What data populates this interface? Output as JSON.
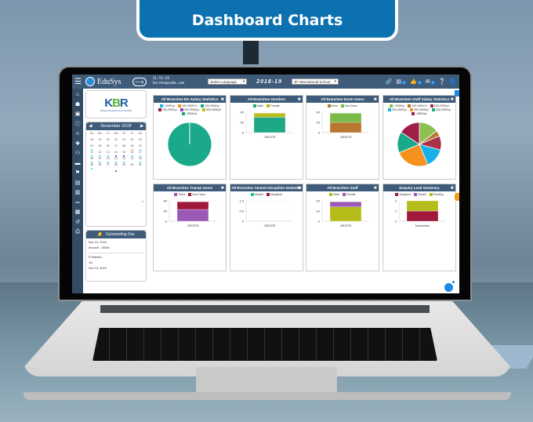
{
  "banner": {
    "title": "Dashboard Charts"
  },
  "topbar": {
    "app_name": "EduSys",
    "time": "11:51:45",
    "email": "harsha@sadm.com",
    "language_select": "Select Language",
    "academic_year": "2018-19",
    "school_select": "JP International School",
    "badges": {
      "messages": "0",
      "likes": "0",
      "mail": "0"
    }
  },
  "nav_icons": [
    "home-icon",
    "bank-icon",
    "monitor-icon",
    "info-icon",
    "user-icon",
    "user-add-icon",
    "group-icon",
    "card-icon",
    "flag-icon",
    "document-icon",
    "book-icon",
    "bed-icon",
    "bus-icon",
    "history-icon",
    "print-icon"
  ],
  "logo": {
    "text_k": "K",
    "text_b": "B",
    "text_r": "R",
    "tagline": "Software Development & Consulting"
  },
  "calendar": {
    "month": "November 2018",
    "weekdays": [
      "Su",
      "Mo",
      "Tu",
      "We",
      "Th",
      "Fr",
      "Sa"
    ],
    "days": [
      {
        "d": "28"
      },
      {
        "d": "29"
      },
      {
        "d": "30"
      },
      {
        "d": "31"
      },
      {
        "d": "01"
      },
      {
        "d": "02"
      },
      {
        "d": "03"
      },
      {
        "d": "04",
        "dot": "c"
      },
      {
        "d": "05"
      },
      {
        "d": "06"
      },
      {
        "d": "07"
      },
      {
        "d": "08"
      },
      {
        "d": "09",
        "dot": "o"
      },
      {
        "d": "10",
        "dot": "c"
      },
      {
        "d": "11",
        "dot": "c"
      },
      {
        "d": "12",
        "dot": "c"
      },
      {
        "d": "13",
        "dot": "c"
      },
      {
        "d": "14",
        "dot": "b"
      },
      {
        "d": "15",
        "dot": "b"
      },
      {
        "d": "16",
        "dot": "c"
      },
      {
        "d": "17",
        "dot": "c"
      },
      {
        "d": "18",
        "dot": "c"
      },
      {
        "d": "19",
        "dot": "c"
      },
      {
        "d": "20",
        "dot": "c"
      },
      {
        "d": "21",
        "dot": "c"
      },
      {
        "d": "22",
        "dot": "c"
      },
      {
        "d": "23"
      },
      {
        "d": "24",
        "dot": "c"
      },
      {
        "d": "25",
        "dot": "c"
      },
      {
        "d": "26"
      },
      {
        "d": "27"
      },
      {
        "d": "28"
      },
      {
        "d": "29"
      },
      {
        "d": "30"
      },
      {
        "d": "01"
      }
    ]
  },
  "outstanding_fee": {
    "title": "Outstanding Fee",
    "entries": [
      {
        "line1": "Nov 13, 2018",
        "line2": "Amount : 18500"
      },
      {
        "line1": "R Rakesh,",
        "line2": "1A,",
        "line3": "Nov 13, 2018"
      }
    ]
  },
  "panels": [
    {
      "title": "All Branches BA Salary Statistics"
    },
    {
      "title": "All Branches Genders"
    },
    {
      "title": "All Branches Dorm Users"
    },
    {
      "title": "All Branches Staff Salary Statistics"
    },
    {
      "title": "All Branches Transp Users"
    },
    {
      "title": "All Branches Absent Discipline Statistics"
    },
    {
      "title": "All Branches Staff"
    },
    {
      "title": "Enquiry Lead Summary"
    }
  ],
  "chart_data": [
    {
      "type": "pie",
      "title": "All Branches BA Salary Statistics",
      "legend": [
        "<100K/yr",
        "100-150K/Yr",
        "150-200K/yr",
        "200-250K/yr",
        "250-300K/yr",
        "300-350K/yr",
        ">350K/yr"
      ],
      "colors": [
        "#1cb0e6",
        "#f5921e",
        "#1aaa8a",
        "#a0193c",
        "#8e44ad",
        "#b5bd1a",
        "#1aaa8a"
      ],
      "values": [
        0,
        0,
        0,
        0,
        0,
        0,
        99
      ],
      "slices": [
        {
          "label": "<100K/yr",
          "value": 1
        },
        {
          "label": ">350K/yr",
          "value": 99
        }
      ]
    },
    {
      "type": "bar",
      "title": "All Branches Genders",
      "categories": [
        "JIS2275"
      ],
      "series": [
        {
          "name": "Male",
          "values": [
            30
          ],
          "color": "#1fa885"
        },
        {
          "name": "Female",
          "values": [
            8
          ],
          "color": "#b8bd1a"
        }
      ],
      "yticks": [
        "40",
        "20",
        "0"
      ],
      "ylim": [
        0,
        40
      ]
    },
    {
      "type": "bar",
      "title": "All Branches Dorm Users",
      "categories": [
        "JIS2275"
      ],
      "series": [
        {
          "name": "Dorm",
          "values": [
            20
          ],
          "color": "#b8782f"
        },
        {
          "name": "Non-Dorm",
          "values": [
            18
          ],
          "color": "#7cba4a"
        }
      ],
      "yticks": [
        "40",
        "20",
        "0"
      ],
      "ylim": [
        0,
        40
      ]
    },
    {
      "type": "pie",
      "title": "All Branches Staff Salary Statistics",
      "legend": [
        "<100K/yr",
        "100-150K/Yr",
        "150-200K/yr",
        "200-250K/yr",
        "250-300K/yr",
        "300-350K/yr",
        ">350K/yr"
      ],
      "colors": [
        "#8cc152",
        "#b8782f",
        "#a83248",
        "#17b0e8",
        "#f5921e",
        "#1aaa8a",
        "#9e1e45"
      ],
      "values": [
        14,
        4,
        10,
        14,
        24,
        15,
        15
      ]
    },
    {
      "type": "bar",
      "title": "All Branches Transp Users",
      "categories": [
        "JIS2275"
      ],
      "series": [
        {
          "name": "Trans",
          "values": [
            23
          ],
          "color": "#9b59b6"
        },
        {
          "name": "Non-Trans",
          "values": [
            15
          ],
          "color": "#a0193c"
        }
      ],
      "yticks": [
        "40",
        "20",
        "0"
      ],
      "ylim": [
        0,
        40
      ]
    },
    {
      "type": "bar",
      "title": "All Branches Absent Discipline Statistics",
      "categories": [
        "JIS2275"
      ],
      "series": [
        {
          "name": "Absent",
          "values": [
            0
          ],
          "color": "#1abc9c"
        },
        {
          "name": "Discipline",
          "values": [
            0
          ],
          "color": "#a0193c"
        }
      ],
      "yticks": [
        "1.5",
        "0.5",
        "0"
      ],
      "ylim": [
        0,
        1.5
      ]
    },
    {
      "type": "bar",
      "title": "All Branches Staff",
      "categories": [
        "JIS2275"
      ],
      "series": [
        {
          "name": "Male",
          "values": [
            14
          ],
          "color": "#b5bd1a"
        },
        {
          "name": "Female",
          "values": [
            5
          ],
          "color": "#9b59b6"
        }
      ],
      "yticks": [
        "20",
        "10",
        "0"
      ],
      "ylim": [
        0,
        20
      ]
    },
    {
      "type": "bar",
      "title": "Enquiry Lead Summary",
      "categories": [
        "November"
      ],
      "series": [
        {
          "name": "Assigned",
          "values": [
            1
          ],
          "color": "#a0193c"
        },
        {
          "name": "Closed",
          "values": [
            0
          ],
          "color": "#9b59b6"
        },
        {
          "name": "Pending",
          "values": [
            1
          ],
          "color": "#b5bd1a"
        }
      ],
      "yticks": [
        "2",
        "1",
        "0"
      ],
      "ylim": [
        0,
        2
      ]
    }
  ]
}
